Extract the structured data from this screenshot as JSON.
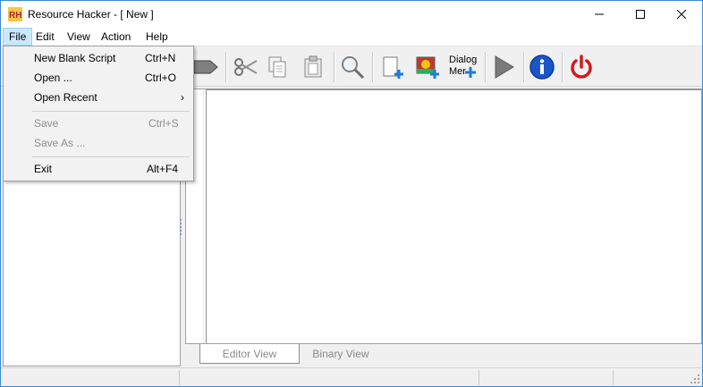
{
  "window": {
    "title": "Resource Hacker - [ New ]",
    "app_icon_text": "RH"
  },
  "menubar": {
    "items": [
      {
        "label": "File",
        "active": true
      },
      {
        "label": "Edit",
        "active": false
      },
      {
        "label": "View",
        "active": false
      },
      {
        "label": "Action",
        "active": false
      },
      {
        "label": "Help",
        "active": false
      }
    ]
  },
  "toolbar": {
    "icons": [
      "compile-arrow-icon",
      "cut-icon",
      "copy-icon",
      "paste-icon",
      "find-icon",
      "add-blank-resource-icon",
      "add-image-resource-icon",
      "dialog-merger-icon",
      "run-script-icon",
      "about-info-icon",
      "exit-power-icon"
    ],
    "dialog_label_line1": "Dialog",
    "dialog_label_line2": "Mer"
  },
  "file_menu": {
    "new_blank_script": {
      "label": "New Blank Script",
      "shortcut": "Ctrl+N"
    },
    "open": {
      "label": "Open ...",
      "shortcut": "Ctrl+O"
    },
    "open_recent": {
      "label": "Open Recent",
      "arrow": "›"
    },
    "save": {
      "label": "Save",
      "shortcut": "Ctrl+S",
      "disabled": true
    },
    "save_as": {
      "label": "Save As ...",
      "disabled": true
    },
    "exit": {
      "label": "Exit",
      "shortcut": "Alt+F4"
    }
  },
  "tabs": {
    "editor_view": "Editor View",
    "binary_view": "Binary View"
  },
  "colors": {
    "menu_highlight": "#cce8ff",
    "info_blue": "#1a56c9",
    "power_red": "#d11a1a",
    "play_gray": "#7a7a7a"
  }
}
